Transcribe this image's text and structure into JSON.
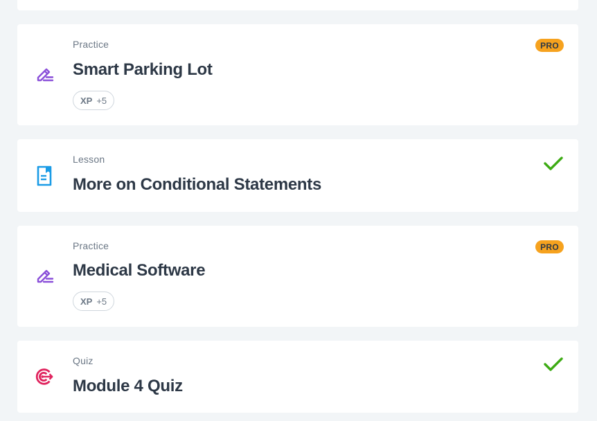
{
  "items": [
    {
      "type": "Practice",
      "title": "Smart Parking Lot",
      "xp_label": "XP",
      "xp_value": "+5",
      "badge": "PRO",
      "icon": "pencil-practice-icon"
    },
    {
      "type": "Lesson",
      "title": "More on Conditional Statements",
      "status": "completed",
      "icon": "lesson-document-icon"
    },
    {
      "type": "Practice",
      "title": "Medical Software",
      "xp_label": "XP",
      "xp_value": "+5",
      "badge": "PRO",
      "icon": "pencil-practice-icon"
    },
    {
      "type": "Quiz",
      "title": "Module 4 Quiz",
      "status": "completed",
      "icon": "target-quiz-icon"
    }
  ],
  "colors": {
    "background": "#f2f5f7",
    "practice_icon": "#8a4fd9",
    "lesson_icon": "#1a9be6",
    "quiz_icon": "#e0245e",
    "pro_badge": "#f6a21e",
    "check": "#3dab14",
    "title": "#2d3846",
    "muted": "#6b7785"
  }
}
